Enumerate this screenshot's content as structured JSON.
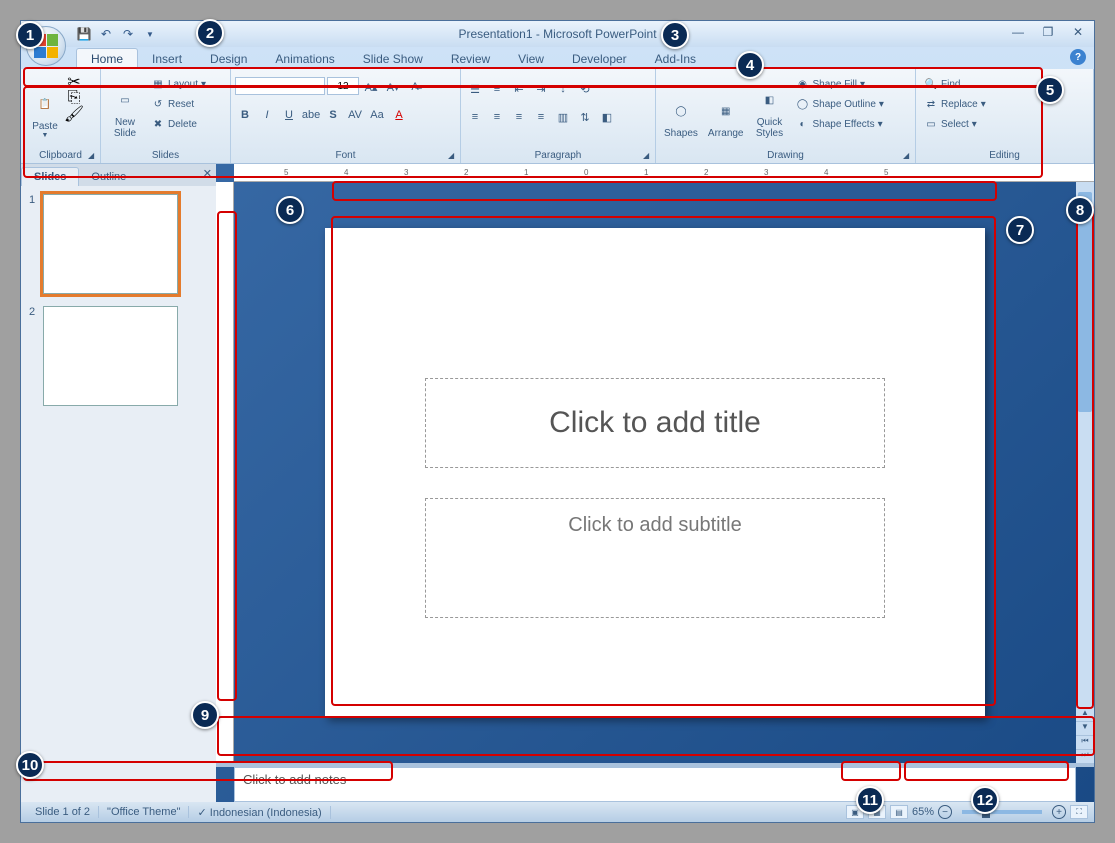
{
  "title": "Presentation1 - Microsoft PowerPoint",
  "tabs": [
    "Home",
    "Insert",
    "Design",
    "Animations",
    "Slide Show",
    "Review",
    "View",
    "Developer",
    "Add-Ins"
  ],
  "active_tab": "Home",
  "ribbon": {
    "clipboard": {
      "label": "Clipboard",
      "paste": "Paste"
    },
    "slides": {
      "label": "Slides",
      "new_slide": "New\nSlide",
      "layout": "Layout",
      "reset": "Reset",
      "delete": "Delete"
    },
    "font": {
      "label": "Font",
      "font_name": "",
      "font_size": "12"
    },
    "paragraph": {
      "label": "Paragraph"
    },
    "drawing": {
      "label": "Drawing",
      "shapes": "Shapes",
      "arrange": "Arrange",
      "quick_styles": "Quick\nStyles",
      "shape_fill": "Shape Fill",
      "shape_outline": "Shape Outline",
      "shape_effects": "Shape Effects"
    },
    "editing": {
      "label": "Editing",
      "find": "Find",
      "replace": "Replace",
      "select": "Select"
    }
  },
  "panel": {
    "tabs": [
      "Slides",
      "Outline"
    ],
    "active": "Slides",
    "slides": [
      1,
      2
    ],
    "selected": 1
  },
  "slide": {
    "title_placeholder": "Click to add title",
    "subtitle_placeholder": "Click to add subtitle"
  },
  "notes": {
    "placeholder": "Click to add notes"
  },
  "status": {
    "slide_info": "Slide 1 of 2",
    "theme": "\"Office Theme\"",
    "language": "Indonesian (Indonesia)",
    "zoom": "65%"
  },
  "callouts": [
    "1",
    "2",
    "3",
    "4",
    "5",
    "6",
    "7",
    "8",
    "9",
    "10",
    "11",
    "12"
  ]
}
